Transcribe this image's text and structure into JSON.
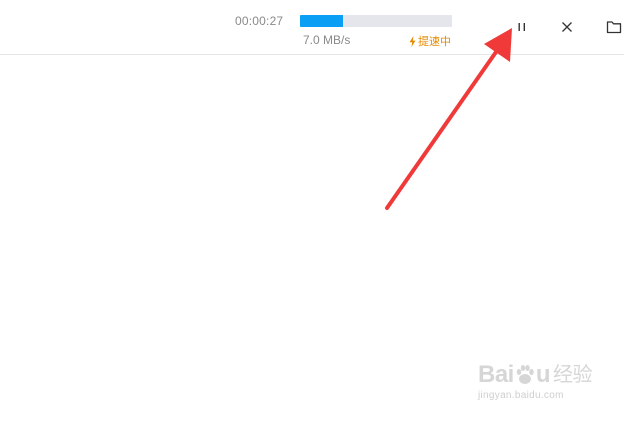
{
  "download": {
    "elapsed_time": "00:00:27",
    "progress_fraction": 0.28,
    "speed": "7.0 MB/s",
    "boost_label": "提速中"
  },
  "controls": {
    "pause_icon": "pause-icon",
    "close_icon": "close-icon",
    "folder_icon": "folder-icon"
  },
  "watermark": {
    "logo_left": "Bai",
    "logo_right": "u",
    "logo_cn": "经验",
    "url": "jingyan.baidu.com"
  },
  "colors": {
    "progress_fill": "#0a9ff5",
    "progress_track": "#e4e6eb",
    "boost": "#e58a00",
    "arrow": "#f03a3a"
  }
}
